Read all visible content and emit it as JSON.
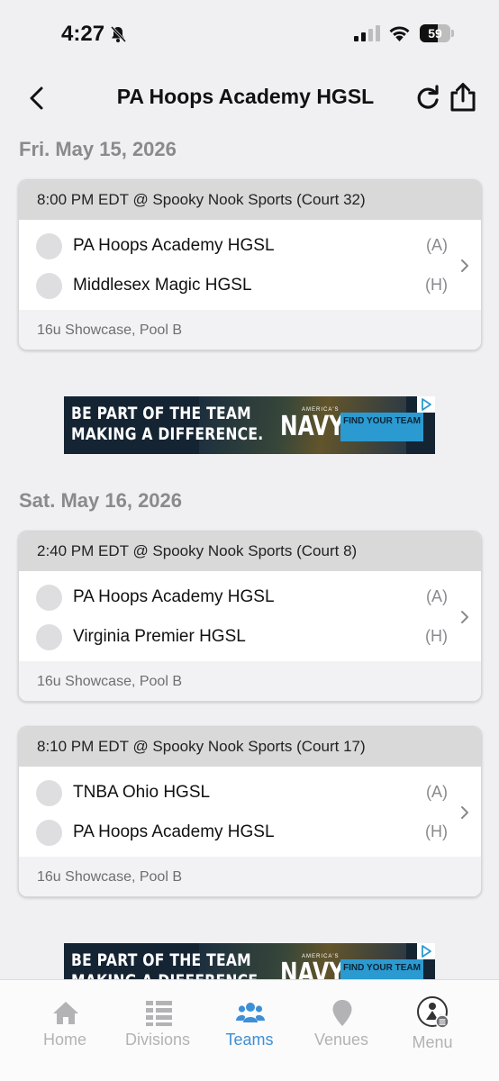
{
  "status_bar": {
    "time": "4:27",
    "battery_level": "59",
    "battery_fraction": 0.59
  },
  "header": {
    "title": "PA Hoops Academy HGSL"
  },
  "icons": {
    "back": "chevron-left-icon",
    "refresh": "refresh-icon",
    "share": "share-icon",
    "bell": "bell-slash-icon"
  },
  "colors": {
    "accent": "#3d8fd6",
    "background": "#f0f0f2",
    "card_header": "#d9d9d9",
    "ad_background": "#152433",
    "ad_cta": "#2b9ad0"
  },
  "days": [
    {
      "date": "Fri. May 15, 2026",
      "games": [
        {
          "time_venue": "8:00 PM EDT @ Spooky Nook Sports (Court 32)",
          "teams": [
            {
              "name": "PA Hoops Academy HGSL",
              "side": "(A)"
            },
            {
              "name": "Middlesex Magic HGSL",
              "side": "(H)"
            }
          ],
          "division": "16u Showcase, Pool B"
        }
      ]
    },
    {
      "date": "Sat. May 16, 2026",
      "games": [
        {
          "time_venue": "2:40 PM EDT @ Spooky Nook Sports (Court 8)",
          "teams": [
            {
              "name": "PA Hoops Academy HGSL",
              "side": "(A)"
            },
            {
              "name": "Virginia Premier HGSL",
              "side": "(H)"
            }
          ],
          "division": "16u Showcase, Pool B"
        },
        {
          "time_venue": "8:10 PM EDT @ Spooky Nook Sports (Court 17)",
          "teams": [
            {
              "name": "TNBA Ohio HGSL",
              "side": "(A)"
            },
            {
              "name": "PA Hoops Academy HGSL",
              "side": "(H)"
            }
          ],
          "division": "16u Showcase, Pool B"
        }
      ]
    }
  ],
  "ad": {
    "line1": "BE PART OF THE TEAM",
    "line2": "MAKING A DIFFERENCE.",
    "brand_small": "AMERICA'S",
    "brand": "NAVY",
    "cta": "FIND YOUR TEAM"
  },
  "tabs": [
    {
      "label": "Home",
      "icon": "home-icon",
      "active": false
    },
    {
      "label": "Divisions",
      "icon": "list-icon",
      "active": false
    },
    {
      "label": "Teams",
      "icon": "people-icon",
      "active": true
    },
    {
      "label": "Venues",
      "icon": "map-pin-icon",
      "active": false
    },
    {
      "label": "Menu",
      "icon": "menu-avatar-icon",
      "active": false
    }
  ]
}
